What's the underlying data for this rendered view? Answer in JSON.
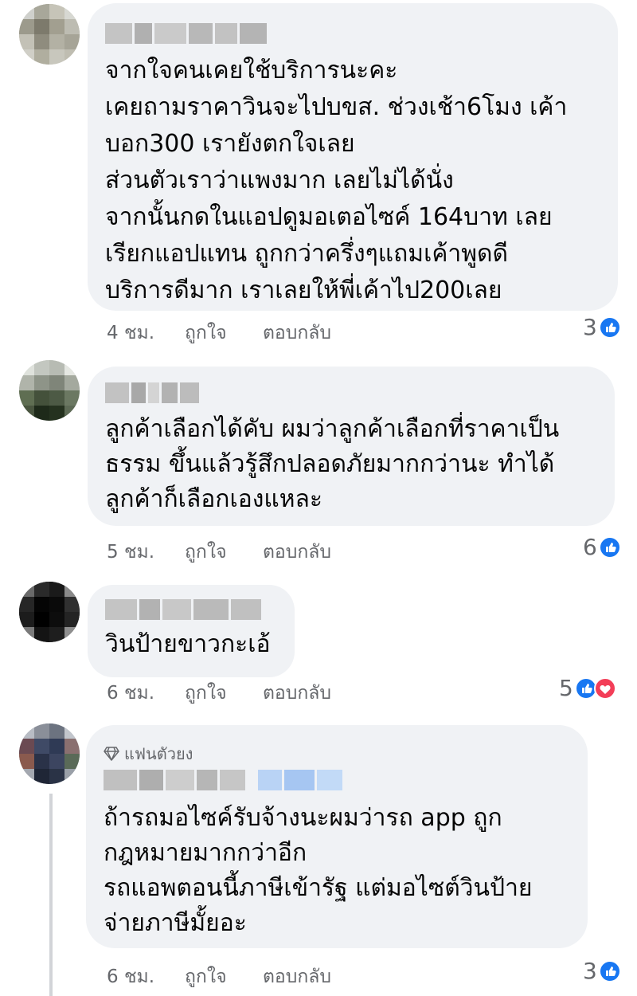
{
  "comments": [
    {
      "lines": [
        "จากใจคนเคยใช้บริการนะคะ",
        "เคยถามราคาวินจะไปบขส. ช่วงเช้า6โมง เค้า",
        "บอก300 เรายังตกใจเลย",
        "ส่วนตัวเราว่าแพงมาก เลยไม่ได้นั่ง",
        "จากนั้นกดในแอปดูมอเตอไซค์ 164บาท เลย",
        "เรียกแอปแทน ถูกกว่าครึ่งๆแถมเค้าพูดดี",
        "บริการดีมาก เราเลยให้พี่เค้าไป200เลย"
      ],
      "time": "4 ชม.",
      "like": "ถูกใจ",
      "reply": "ตอบกลับ",
      "reaction_count": "3"
    },
    {
      "lines": [
        "ลูกค้าเลือกได้คับ ผมว่าลูกค้าเลือกที่ราคาเป็น",
        "ธรรม ขึ้นแล้วรู้สึกปลอดภัยมากกว่านะ ทำได้",
        "ลูกค้าก็เลือกเองแหละ"
      ],
      "time": "5 ชม.",
      "like": "ถูกใจ",
      "reply": "ตอบกลับ",
      "reaction_count": "6"
    },
    {
      "lines": [
        "วินป้ายขาวกะเอ้"
      ],
      "time": "6 ชม.",
      "like": "ถูกใจ",
      "reply": "ตอบกลับ",
      "reaction_count": "5"
    },
    {
      "badge": "แฟนตัวยง",
      "lines": [
        "ถ้ารถมอไซค์รับจ้างนะผมว่ารถ app ถูก",
        "กฎหมายมากกว่าอีก",
        "รถแอพตอนนี้ภาษีเข้ารัฐ แต่มอไซต์วินป้าย",
        "จ่ายภาษีมั้ยอะ"
      ],
      "time": "6 ชม.",
      "like": "ถูกใจ",
      "reply": "ตอบกลับ",
      "reaction_count": "3"
    }
  ],
  "colors": {
    "bubble": "#f0f2f5",
    "meta": "#65676b",
    "like_blue": "#1877f2",
    "love_red": "#f33e58"
  },
  "icons": [
    "like-icon",
    "love-icon",
    "diamond-icon"
  ]
}
